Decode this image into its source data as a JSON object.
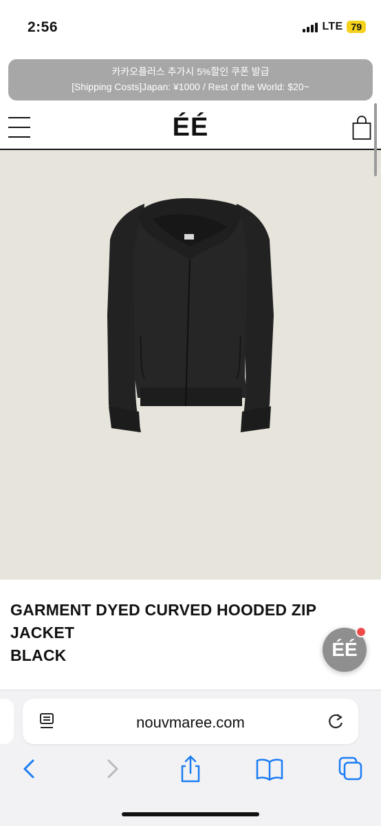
{
  "status_bar": {
    "time": "2:56",
    "network": "LTE",
    "battery": "79"
  },
  "banner": {
    "line1": "카카오플러스 추가시 5%할인 쿠폰 발급",
    "line2": "[Shipping Costs]Japan: ¥1000 / Rest of the World: $20~"
  },
  "header": {
    "logo": "ÉÉ"
  },
  "product": {
    "name": "GARMENT DYED CURVED HOODED ZIP JACKET",
    "color": "BLACK"
  },
  "chat": {
    "label": "ÉÉ"
  },
  "browser": {
    "url": "nouvmaree.com"
  },
  "colors": {
    "banner_bg": "#a7a7a7",
    "image_bg": "#e7e4dc",
    "battery": "#f5d21b",
    "accent_blue": "#1a7cf5"
  },
  "icons": [
    "menu-icon",
    "shopping-bag-icon",
    "reader-icon",
    "reload-icon",
    "back-icon",
    "forward-icon",
    "share-icon",
    "bookmarks-icon",
    "tabs-icon"
  ]
}
